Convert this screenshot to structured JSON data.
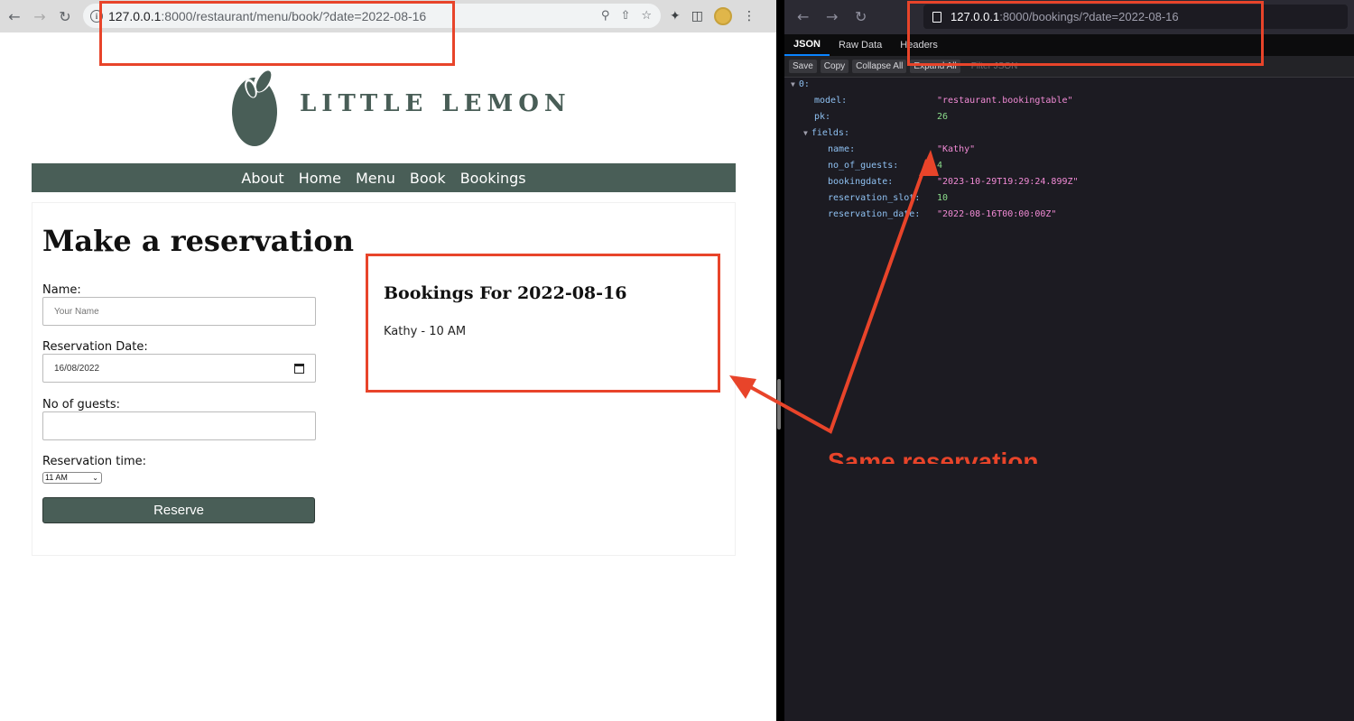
{
  "left_browser": {
    "url_host": "127.0.0.1",
    "url_rest": ":8000/restaurant/menu/book/?date=2022-08-16",
    "logo_text": "LITTLE LEMON",
    "nav": [
      "About",
      "Home",
      "Menu",
      "Book",
      "Bookings"
    ],
    "form": {
      "title": "Make a reservation",
      "name_label": "Name:",
      "name_placeholder": "Your Name",
      "date_label": "Reservation Date:",
      "date_value": "16/08/2022",
      "guests_label": "No of guests:",
      "time_label": "Reservation time:",
      "time_value": "11 AM",
      "submit_label": "Reserve"
    },
    "bookings": {
      "title": "Bookings For 2022-08-16",
      "entry": "Kathy - 10 AM"
    }
  },
  "right_browser": {
    "url_host": "127.0.0.1",
    "url_rest": ":8000/bookings/?date=2022-08-16",
    "tabs": [
      "JSON",
      "Raw Data",
      "Headers"
    ],
    "actions": [
      "Save",
      "Copy",
      "Collapse All",
      "Expand All"
    ],
    "filter_placeholder": "Filter JSON",
    "json": {
      "index": "0:",
      "model_key": "model:",
      "model_val": "\"restaurant.bookingtable\"",
      "pk_key": "pk:",
      "pk_val": "26",
      "fields_key": "fields:",
      "name_key": "name:",
      "name_val": "\"Kathy\"",
      "guests_key": "no_of_guests:",
      "guests_val": "4",
      "bookingdate_key": "bookingdate:",
      "bookingdate_val": "\"2023-10-29T19:29:24.899Z\"",
      "slot_key": "reservation_slot:",
      "slot_val": "10",
      "resdate_key": "reservation_date:",
      "resdate_val": "\"2022-08-16T00:00:00Z\""
    }
  },
  "annotation": {
    "caption": "Same reservation",
    "color": "#e8442a"
  },
  "colors": {
    "brand_green": "#495e57",
    "annotation_red": "#e8442a"
  }
}
